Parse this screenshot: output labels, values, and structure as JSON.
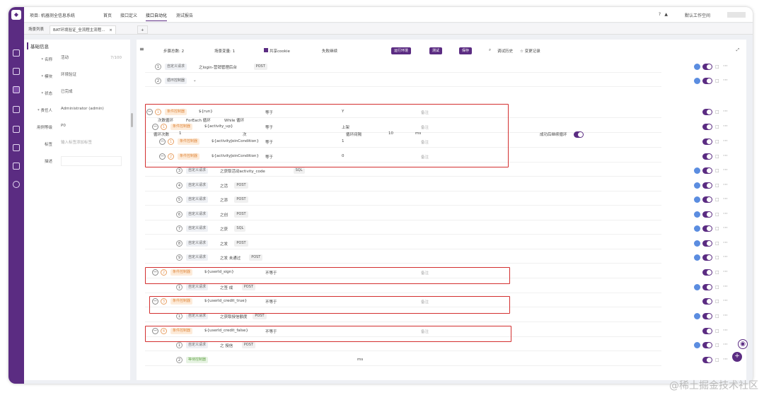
{
  "nav": {
    "project": "项目: 机器测全信息系统",
    "items": [
      "首页",
      "接口定义",
      "接口自动化",
      "测试报告"
    ],
    "active": "接口自动化",
    "right_text": "默认工作空间"
  },
  "tabs": {
    "scene_list": "场景列表",
    "current": "BAT环境验证_全流程主流程...",
    "close": "×",
    "add": "+"
  },
  "left": {
    "section_title": "基础信息",
    "fields": [
      {
        "label": "* 名称",
        "value": "活动",
        "extra": "7/100"
      },
      {
        "label": "* 模块",
        "value": "环境验证"
      },
      {
        "label": "* 状态",
        "value": "已完成"
      },
      {
        "label": "* 责任人",
        "value": "Administrator (admin)"
      },
      {
        "label": "用例等级",
        "value": "P0"
      },
      {
        "label": "标签",
        "value": "输入标签添加标签"
      },
      {
        "label": "描述",
        "value": ""
      }
    ]
  },
  "toolbar": {
    "menu_icon": "≡",
    "steps": "步骤总数: 2",
    "vars": "场景变量: 1",
    "share_cookie": "共享cookie",
    "fail_continue": "失败继续",
    "run_env": "运行环境",
    "debug": "测试",
    "save": "保存",
    "history": "调试历史",
    "changes": "变更记录"
  },
  "loop": {
    "options": [
      "次数循环",
      "ForEach 循环",
      "While 循环"
    ],
    "count_label": "循环次数",
    "count_value": "1",
    "count_unit": "次",
    "interval_label": "循环间隔",
    "interval_value": "10",
    "interval_unit": "ms",
    "continue_label": "成功后继续循环"
  },
  "rows": [
    {
      "num": "1",
      "tag": "自定义请求",
      "tag_color": "gray",
      "text": "之login-营销管理后台",
      "method": "POST",
      "indent": 0,
      "dot": true
    },
    {
      "num": "2",
      "tag": "循环控制器",
      "tag_color": "gray",
      "text": "",
      "method": "",
      "indent": 0,
      "dot": true
    },
    {
      "num": "1",
      "tag": "条件控制器",
      "tag_color": "org",
      "text": "${run}",
      "op": "等于",
      "val": "Y",
      "ph": "备注",
      "indent": 0,
      "minus": true
    },
    {
      "num": "1",
      "tag": "条件控制器",
      "tag_color": "org",
      "text": "${activity_up}",
      "op": "等于",
      "val": "上架",
      "ph": "备注",
      "indent": 1,
      "minus": true
    },
    {
      "num": "1",
      "tag": "条件控制器",
      "tag_color": "org",
      "text": "${activityJoinCondition}",
      "op": "等于",
      "val": "1",
      "ph": "备注",
      "indent": 2,
      "minus": true
    },
    {
      "num": "2",
      "tag": "条件控制器",
      "tag_color": "org",
      "text": "${activityJoinCondition}",
      "op": "等于",
      "val": "0",
      "ph": "备注",
      "indent": 2,
      "minus": true
    },
    {
      "num": "3",
      "tag": "自定义请求",
      "tag_color": "gray",
      "text": "之获取活动activity_code",
      "method": "SQL",
      "indent": 3,
      "dot": true
    },
    {
      "num": "4",
      "tag": "自定义请求",
      "tag_color": "gray",
      "text": "之活",
      "method": "POST",
      "indent": 3,
      "dot": true
    },
    {
      "num": "5",
      "tag": "自定义请求",
      "tag_color": "gray",
      "text": "之添",
      "method": "POST",
      "indent": 3,
      "dot": true
    },
    {
      "num": "6",
      "tag": "自定义请求",
      "tag_color": "gray",
      "text": "之创",
      "method": "POST",
      "indent": 3,
      "dot": true
    },
    {
      "num": "7",
      "tag": "自定义请求",
      "tag_color": "gray",
      "text": "之获",
      "method": "SQL",
      "indent": 3,
      "dot": true
    },
    {
      "num": "8",
      "tag": "自定义请求",
      "tag_color": "gray",
      "text": "之发",
      "method": "POST",
      "indent": 3,
      "dot": true
    },
    {
      "num": "9",
      "tag": "自定义请求",
      "tag_color": "gray",
      "text": "之发 未通过",
      "method": "POST",
      "indent": 3,
      "dot": true
    },
    {
      "num": "2",
      "tag": "条件控制器",
      "tag_color": "org",
      "text": "${userId_sign}",
      "op": "不等于",
      "val": "",
      "ph": "备注",
      "indent": 1,
      "minus": true
    },
    {
      "num": "1",
      "tag": "自定义请求",
      "tag_color": "gray",
      "text": "之签 成",
      "method": "POST",
      "indent": 3,
      "dot": true
    },
    {
      "num": "3",
      "tag": "条件控制器",
      "tag_color": "org",
      "text": "${userId_credit_true}",
      "op": "不等于",
      "val": "",
      "ph": "备注",
      "indent": 1,
      "minus": true
    },
    {
      "num": "1",
      "tag": "自定义请求",
      "tag_color": "gray",
      "text": "之获取授信额度",
      "method": "POST",
      "indent": 3,
      "dot": true
    },
    {
      "num": "4",
      "tag": "条件控制器",
      "tag_color": "org",
      "text": "${userId_credit_false}",
      "op": "不等于",
      "val": "",
      "ph": "备注",
      "indent": 1,
      "minus": true
    },
    {
      "num": "1",
      "tag": "自定义请求",
      "tag_color": "gray",
      "text": "之 授信",
      "method": "POST",
      "indent": 3,
      "dot": true
    },
    {
      "num": "2",
      "tag": "等待控制器",
      "tag_color": "org-g",
      "text": "",
      "unit": "ms",
      "indent": 3,
      "dot": false
    }
  ],
  "watermark": "@稀土掘金技术社区",
  "colors": {
    "accent": "#5b2c82",
    "highlight": "#d32f2f",
    "tag_orange": "#e08a40",
    "dot_blue": "#5b8de0"
  }
}
